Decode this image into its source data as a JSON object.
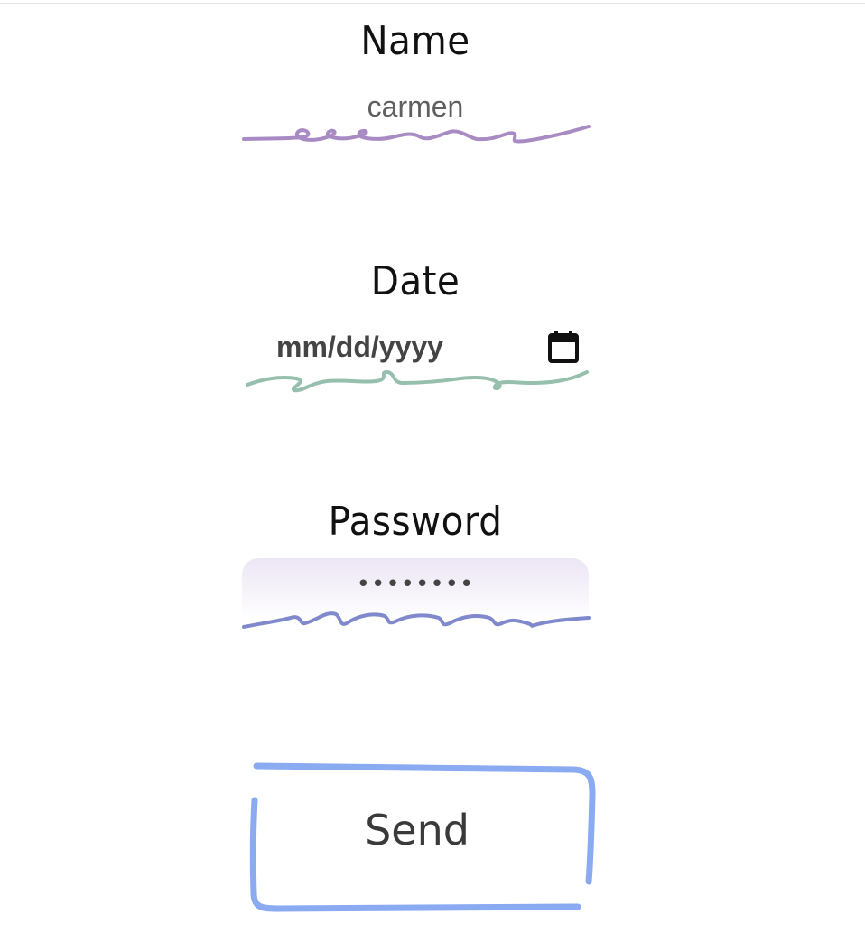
{
  "form": {
    "name": {
      "label": "Name",
      "value": "carmen"
    },
    "date": {
      "label": "Date",
      "placeholder": "mm/dd/yyyy",
      "icon": "calendar-icon"
    },
    "password": {
      "label": "Password",
      "masked_value": "••••••••"
    },
    "submit": {
      "label": "Send"
    }
  },
  "colors": {
    "name_underline": "#a98bc4",
    "date_underline": "#96bfae",
    "password_underline": "#7f89cc",
    "button_border": "#8aaaf2",
    "password_fill": "#ece6f5"
  }
}
